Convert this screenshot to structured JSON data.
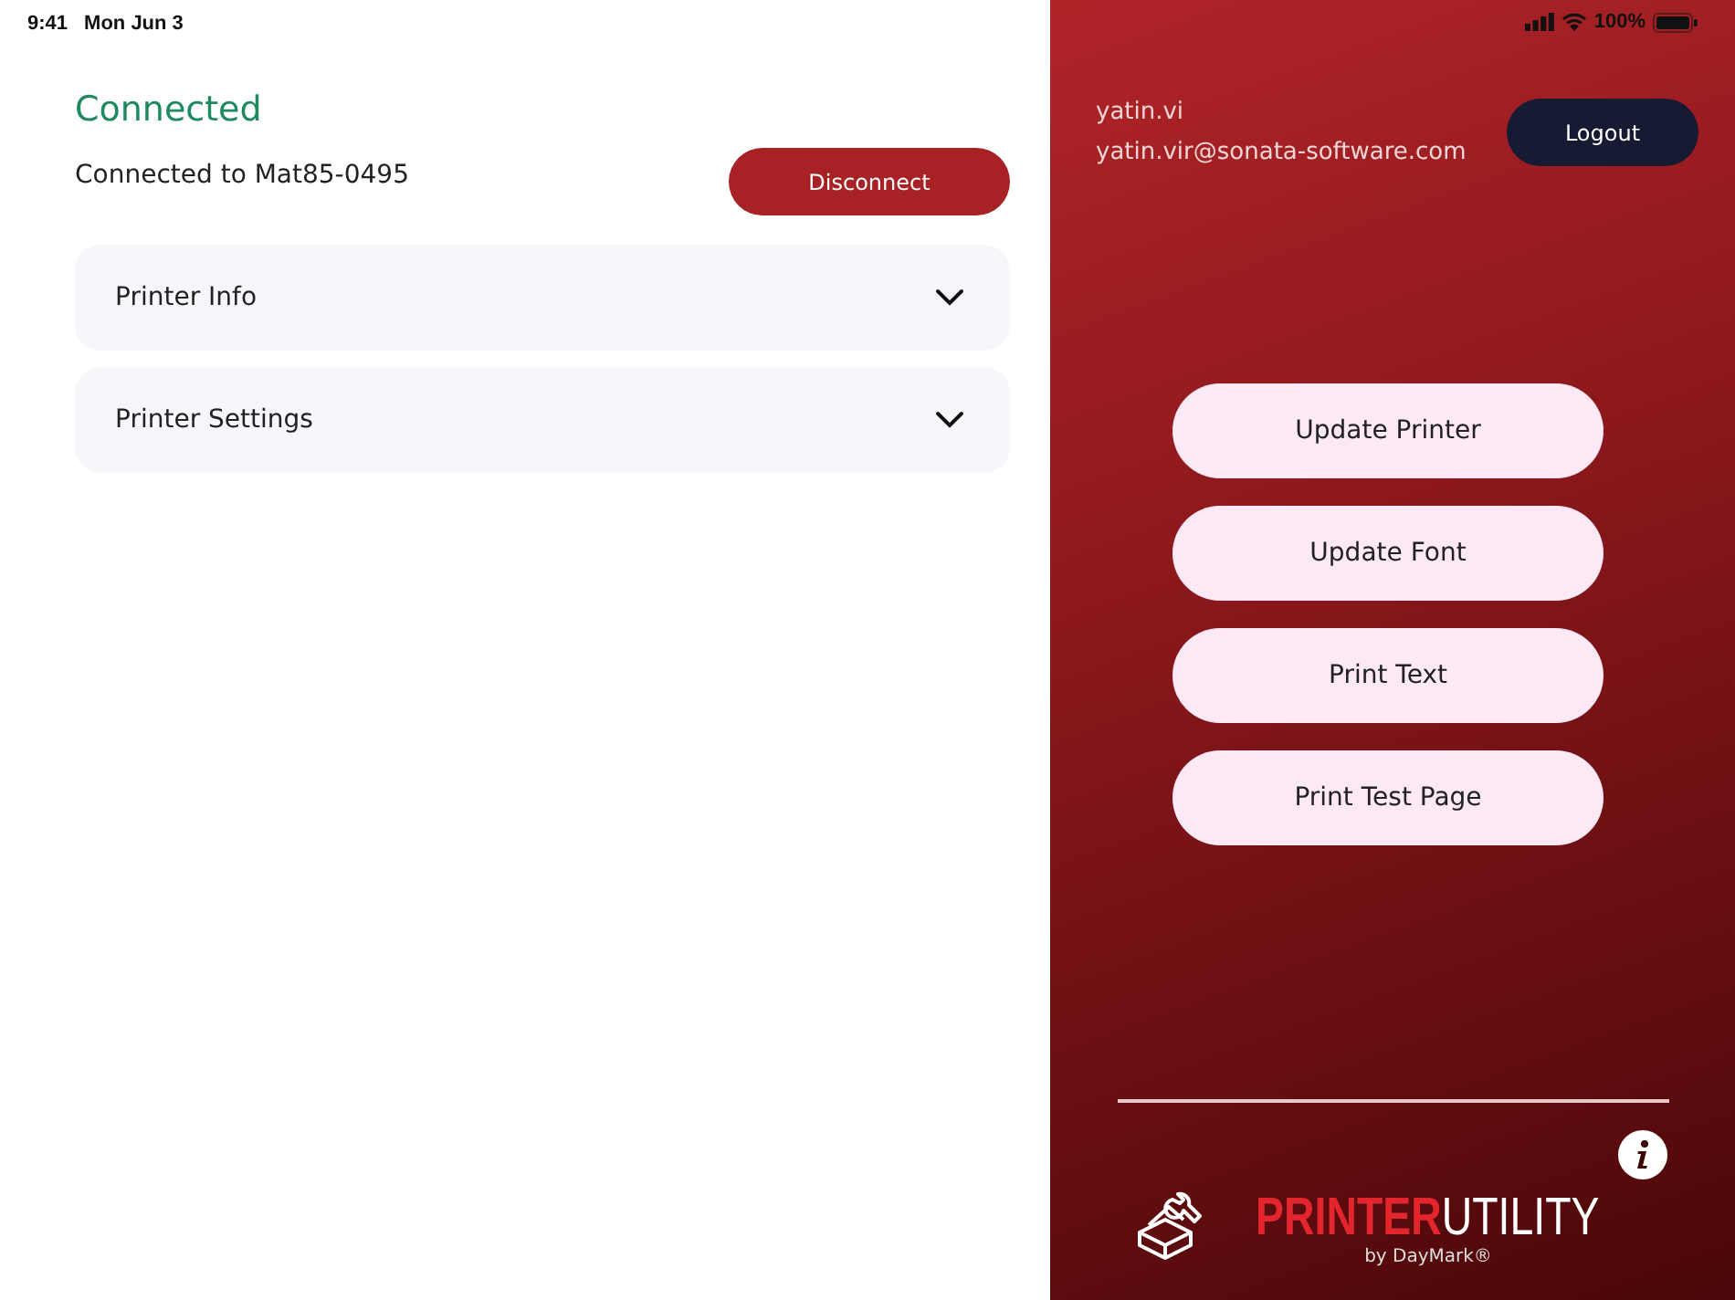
{
  "status_bar": {
    "time": "9:41",
    "date": "Mon Jun 3",
    "battery": "100%"
  },
  "connection": {
    "status": "Connected",
    "detail": "Connected to Mat85-0495",
    "button": "Disconnect"
  },
  "sections": [
    {
      "label": "Printer Info",
      "expanded": false
    },
    {
      "label": "Printer Settings",
      "expanded": false
    }
  ],
  "user": {
    "username": "yatin.vi",
    "email": "yatin.vir@sonata-software.com",
    "logout": "Logout"
  },
  "actions": [
    "Update Printer",
    "Update Font",
    "Print Text",
    "Print Test Page"
  ],
  "logo": {
    "brand_part_1": "PRINTER",
    "brand_part_2": "UTILITY",
    "byline": "by DayMark®"
  }
}
